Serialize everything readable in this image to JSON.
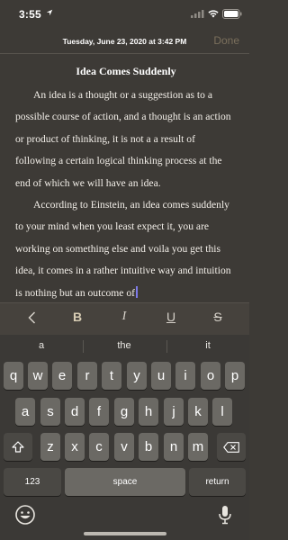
{
  "status_bar": {
    "time": "3:55"
  },
  "header": {
    "date": "Tuesday, June 23, 2020 at 3:42 PM",
    "done_label": "Done"
  },
  "note": {
    "title": "Idea Comes Suddenly",
    "paragraphs": [
      "An idea is a thought or a suggestion as to a possible course of action, and a thought is an action or product of thinking, it is not a a result of following a certain logical thinking process at the end of which we will have an idea.",
      "According to Einstein, an idea comes suddenly to your mind when you least expect it, you are working on something else and voila you get this idea, it comes in a rather intuitive way and intuition is nothing but an outcome of"
    ]
  },
  "format_toolbar": {
    "back": "<",
    "bold": "B",
    "italic": "I",
    "underline": "U",
    "strike": "S"
  },
  "keyboard": {
    "suggestions": [
      "a",
      "the",
      "it"
    ],
    "row1": [
      "q",
      "w",
      "e",
      "r",
      "t",
      "y",
      "u",
      "i",
      "o",
      "p"
    ],
    "row2": [
      "a",
      "s",
      "d",
      "f",
      "g",
      "h",
      "j",
      "k",
      "l"
    ],
    "row3": [
      "z",
      "x",
      "c",
      "v",
      "b",
      "n",
      "m"
    ],
    "numbers_label": "123",
    "space_label": "space",
    "return_label": "return"
  }
}
